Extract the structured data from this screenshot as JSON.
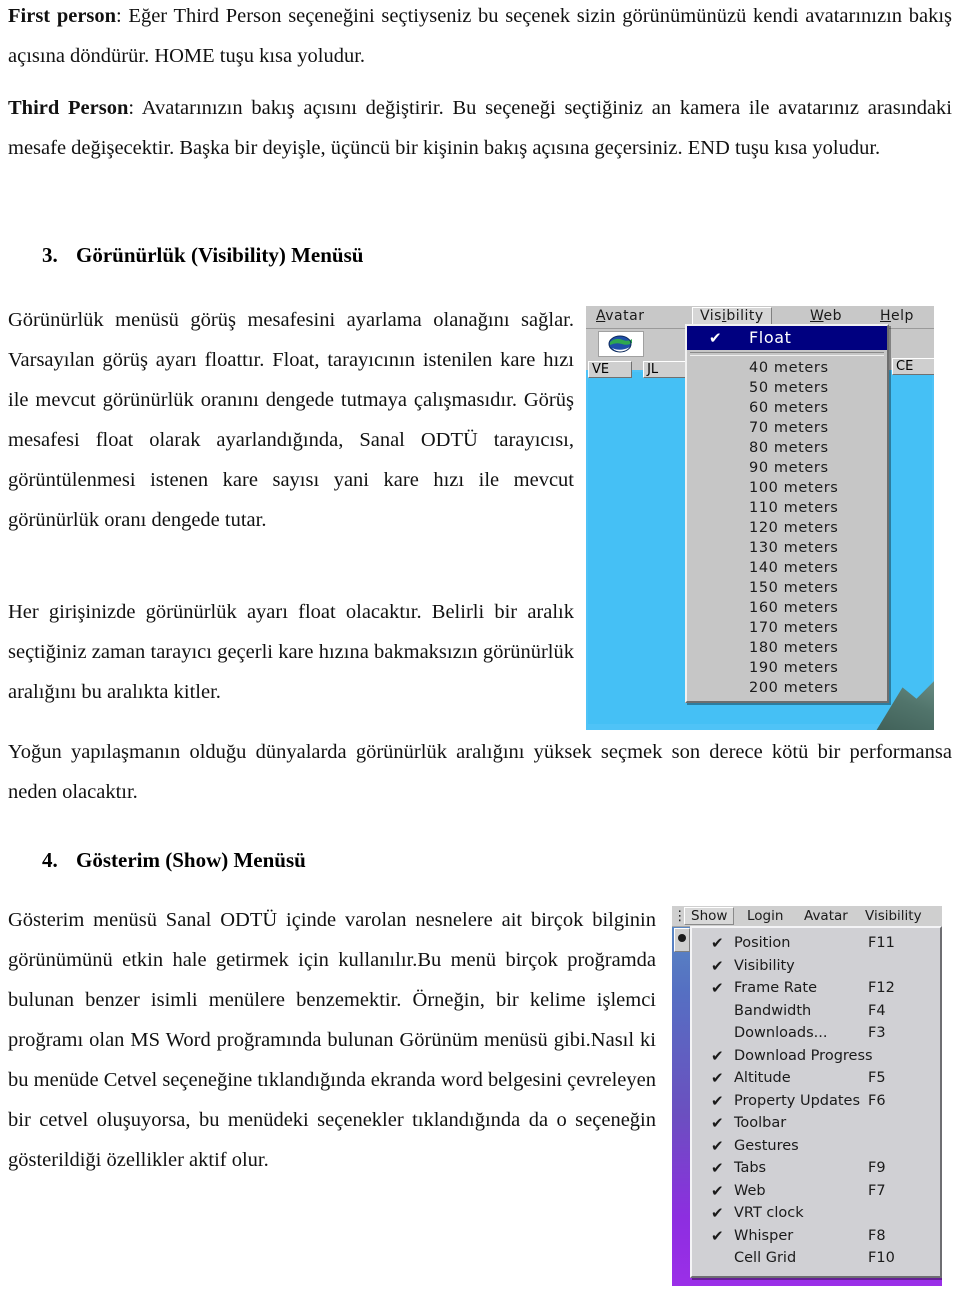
{
  "document": {
    "paragraphs": {
      "first_person": "First person",
      "first_person_body": ": Eğer Third Person seçeneğini seçtiyseniz bu seçenek sizin görünümünüzü kendi avatarınızın bakış açısına döndürür. HOME tuşu kısa yoludur.",
      "third_person": "Third Person",
      "third_person_body": ": Avatarınızın bakış açısını değiştirir. Bu seçeneği seçtiğiniz an kamera ile avatarınız arasındaki mesafe değişecektir. Başka bir deyişle,  üçüncü bir kişinin bakış açısına geçersiniz. END tuşu kısa yoludur.",
      "visibility_text_1": "Görünürlük menüsü görüş mesafesini ayarlama olanağını sağlar. Varsayılan görüş ayarı floattır. Float, tarayıcının istenilen kare hızı ile mevcut görünürlük oranını dengede tutmaya çalışmasıdır. Görüş mesafesi float olarak ayarlandığında, Sanal ODTÜ tarayıcısı, görüntülenmesi istenen kare sayısı yani kare hızı ile mevcut görünürlük oranı dengede tutar.",
      "visibility_text_2": "Her girişinizde görünürlük ayarı float olacaktır. Belirli bir aralık seçtiğiniz zaman tarayıcı geçerli kare hızına bakmaksızın görünürlük aralığını bu aralıkta kitler.",
      "visibility_text_3": "Yoğun yapılaşmanın olduğu dünyalarda görünürlük aralığını yüksek seçmek son derece kötü bir performansa neden olacaktır.",
      "show_text_1": "Gösterim menüsü Sanal ODTÜ içinde varolan nesnelere ait birçok bilginin görünümünü   etkin hale getirmek için kullanılır.Bu menü birçok proğramda bulunan benzer isimli menülere benzemektir. Örneğin, bir kelime işlemci proğramı olan MS Word proğramında bulunan Görünüm menüsü gibi.Nasıl ki bu menüde Cetvel seçeneğine tıklandığında ekranda word belgesini çevreleyen bir cetvel oluşuyorsa, bu menüdeki seçenekler tıklandığında da o seçeneğin gösterildiği özellikler aktif olur."
    },
    "headings": {
      "h3_num": "3.",
      "h3_text": "Görünürlük (Visibility) Menüsü",
      "h4_num": "4.",
      "h4_text": "Gösterim (Show) Menüsü"
    }
  },
  "visibility_screenshot": {
    "menubar": [
      {
        "label": "Avatar",
        "accel_index": 0
      },
      {
        "label": "Visibility",
        "accel_index": 3
      },
      {
        "label": "Web",
        "accel_index": 0
      },
      {
        "label": "Help",
        "accel_index": 0
      }
    ],
    "menubar_labels": {
      "avatar": "Avatar",
      "visibility": "Visibility",
      "web": "Web",
      "help": "Help"
    },
    "toolbar": {
      "globe_icon": "globe-icon",
      "tab_ve": "VE",
      "tab_jl": "JL",
      "tab_ce": "CE"
    },
    "dropdown": {
      "selected_label": "Float",
      "check_glyph": "✔",
      "items": [
        "40 meters",
        "50 meters",
        "60 meters",
        "70 meters",
        "80 meters",
        "90 meters",
        "100 meters",
        "110 meters",
        "120 meters",
        "130 meters",
        "140 meters",
        "150 meters",
        "160 meters",
        "170 meters",
        "180 meters",
        "190 meters",
        "200 meters"
      ]
    },
    "colors": {
      "sky": "#4fc3f7",
      "menu_face": "#c6c6c6",
      "highlight": "#000080",
      "highlight_text": "#ffffff"
    }
  },
  "show_screenshot": {
    "menubar": {
      "leading": "⋮",
      "show": "Show",
      "login": "Login",
      "avatar": "Avatar",
      "visibility": "Visibility"
    },
    "check_glyph": "✔",
    "items": [
      {
        "label": "Position",
        "key": "F11",
        "checked": true
      },
      {
        "label": "Visibility",
        "key": "",
        "checked": true
      },
      {
        "label": "Frame Rate",
        "key": "F12",
        "checked": true
      },
      {
        "label": "Bandwidth",
        "key": "F4",
        "checked": false
      },
      {
        "label": "Downloads...",
        "key": "F3",
        "checked": false
      },
      {
        "label": "Download Progress",
        "key": "",
        "checked": true
      },
      {
        "label": "Altitude",
        "key": "F5",
        "checked": true
      },
      {
        "label": "Property Updates",
        "key": "F6",
        "checked": true
      },
      {
        "label": "Toolbar",
        "key": "",
        "checked": true
      },
      {
        "label": "Gestures",
        "key": "",
        "checked": true
      },
      {
        "label": "Tabs",
        "key": "F9",
        "checked": true
      },
      {
        "label": "Web",
        "key": "F7",
        "checked": true
      },
      {
        "label": "VRT clock",
        "key": "",
        "checked": true
      },
      {
        "label": "Whisper",
        "key": "F8",
        "checked": true
      },
      {
        "label": "Cell Grid",
        "key": "F10",
        "checked": false
      }
    ],
    "colors": {
      "menu_face": "#d0d0d4",
      "background_top": "#5b8fc4",
      "background_bottom": "#9b2fe8"
    }
  }
}
